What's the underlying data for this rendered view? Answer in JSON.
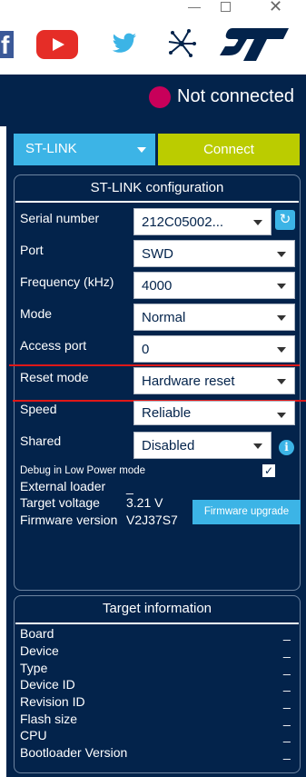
{
  "header": {
    "status_text": "Not connected"
  },
  "top": {
    "probe_select": "ST-LINK",
    "connect_label": "Connect"
  },
  "config": {
    "title": "ST-LINK configuration",
    "serial_number": {
      "label": "Serial number",
      "value": "212C05002..."
    },
    "port": {
      "label": "Port",
      "value": "SWD"
    },
    "frequency": {
      "label": "Frequency (kHz)",
      "value": "4000"
    },
    "mode": {
      "label": "Mode",
      "value": "Normal"
    },
    "access_port": {
      "label": "Access port",
      "value": "0"
    },
    "reset_mode": {
      "label": "Reset mode",
      "value": "Hardware reset"
    },
    "speed": {
      "label": "Speed",
      "value": "Reliable"
    },
    "shared": {
      "label": "Shared",
      "value": "Disabled"
    },
    "debug_low_power": "Debug in Low Power mode",
    "external_loader": {
      "label": "External loader",
      "value": "_"
    },
    "target_voltage": {
      "label": "Target voltage",
      "value": "3.21 V"
    },
    "firmware_version": {
      "label": "Firmware version",
      "value": "V2J37S7"
    },
    "firmware_upgrade": "Firmware upgrade"
  },
  "target": {
    "title": "Target information",
    "rows": [
      {
        "label": "Board",
        "value": "_"
      },
      {
        "label": "Device",
        "value": "_"
      },
      {
        "label": "Type",
        "value": "_"
      },
      {
        "label": "Device ID",
        "value": "_"
      },
      {
        "label": "Revision ID",
        "value": "_"
      },
      {
        "label": "Flash size",
        "value": "_"
      },
      {
        "label": "CPU",
        "value": "_"
      },
      {
        "label": "Bootloader Version",
        "value": "_"
      }
    ]
  },
  "colors": {
    "navy": "#03234b",
    "accent_blue": "#3cb4e6",
    "connect_green": "#bbcc00",
    "status_red": "#c8005a",
    "annotation_red": "#e01818"
  },
  "icons": [
    "facebook-icon",
    "youtube-icon",
    "twitter-icon",
    "network-icon",
    "st-logo"
  ]
}
